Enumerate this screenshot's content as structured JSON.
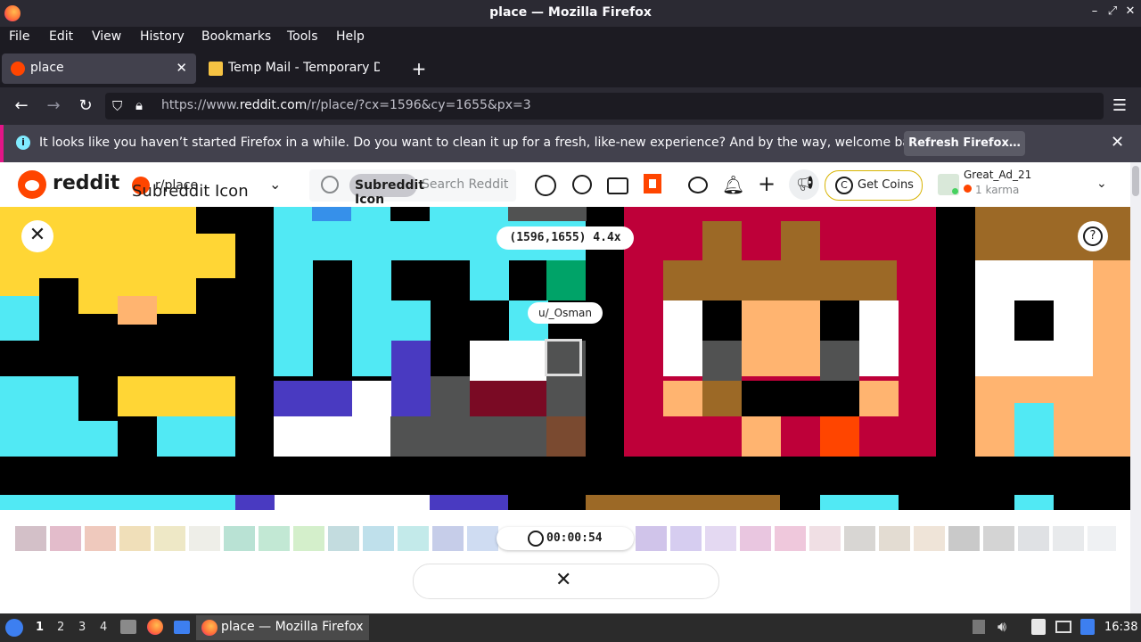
{
  "window": {
    "title": "place — Mozilla Firefox",
    "controls": [
      "–",
      "✕",
      "✕"
    ]
  },
  "menu": [
    "File",
    "Edit",
    "View",
    "History",
    "Bookmarks",
    "Tools",
    "Help"
  ],
  "tabs": [
    {
      "label": "place",
      "active": true
    },
    {
      "label": "Temp Mail - Temporary D",
      "active": false
    }
  ],
  "url": {
    "prefix": "https://www.",
    "domain": "reddit.com",
    "path": "/r/place/?cx=1596&cy=1655&px=3"
  },
  "notification": {
    "message": "It looks like you haven’t started Firefox in a while. Do you want to clean it up for a fresh, like-new experience? And by the way, welcome back!",
    "button": "Refresh Firefox…"
  },
  "reddit": {
    "wordmark": "reddit",
    "subreddit": "r/place",
    "subreddit_icon_alt": "Subreddit Icon",
    "search_icon_alt": "Subreddit Icon",
    "search_placeholder": "Search Reddit",
    "get_coins": "Get Coins",
    "username": "Great_Ad_21",
    "karma": "1 karma"
  },
  "place": {
    "coordinates": "(1596,1655) 4.4x",
    "user_tag": "u/_Osman",
    "timer": "00:00:54",
    "colors": {
      "red": "#be0039",
      "orange": "#ff4500",
      "yellow": "#ffd635",
      "green": "#00a368",
      "cyan": "#51e9f4",
      "blue": "#3690ea",
      "indigo": "#493ac1",
      "brown": "#9c6926",
      "peach": "#ffb470",
      "gray": "#515252",
      "black": "#000000",
      "white": "#ffffff"
    }
  },
  "taskbar": {
    "workspaces": [
      "1",
      "2",
      "3",
      "4"
    ],
    "window_label": "place — Mozilla Firefox",
    "clock": "16:38"
  }
}
